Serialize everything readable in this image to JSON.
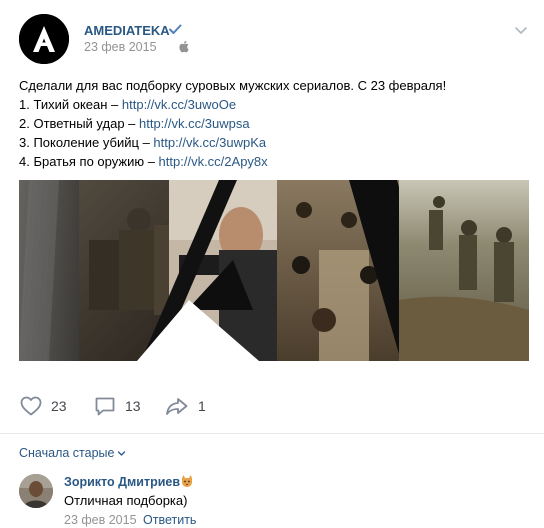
{
  "post": {
    "author": "AMEDIATEKA",
    "date": "23 фев 2015",
    "text_intro": "Сделали для вас подборку суровых мужских сериалов. С 23 февраля!",
    "items": [
      {
        "prefix": "1. Тихий океан – ",
        "link": "http://vk.cc/3uwoOe"
      },
      {
        "prefix": "2. Ответный удар – ",
        "link": "http://vk.cc/3uwpsa"
      },
      {
        "prefix": "3. Поколение убийц – ",
        "link": "http://vk.cc/3uwpKa"
      },
      {
        "prefix": "4. Братья по оружию – ",
        "link": "http://vk.cc/2Apy8x"
      }
    ]
  },
  "actions": {
    "likes": "23",
    "comments": "13",
    "shares": "1"
  },
  "comments_section": {
    "sort_label": "Сначала старые",
    "comment": {
      "author": "Зорикто Дмитриев",
      "text": "Отличная подборка)",
      "date": "23 фев 2015",
      "reply_label": "Ответить"
    }
  },
  "colors": {
    "link": "#2a5885",
    "meta": "#939393",
    "verified": "#5181b8",
    "action_icon": "#828a99"
  },
  "icons": [
    "amediateka-logo",
    "verified-icon",
    "apple-icon",
    "chevron-down-icon",
    "heart-icon",
    "comment-icon",
    "share-icon",
    "cat-icon"
  ]
}
